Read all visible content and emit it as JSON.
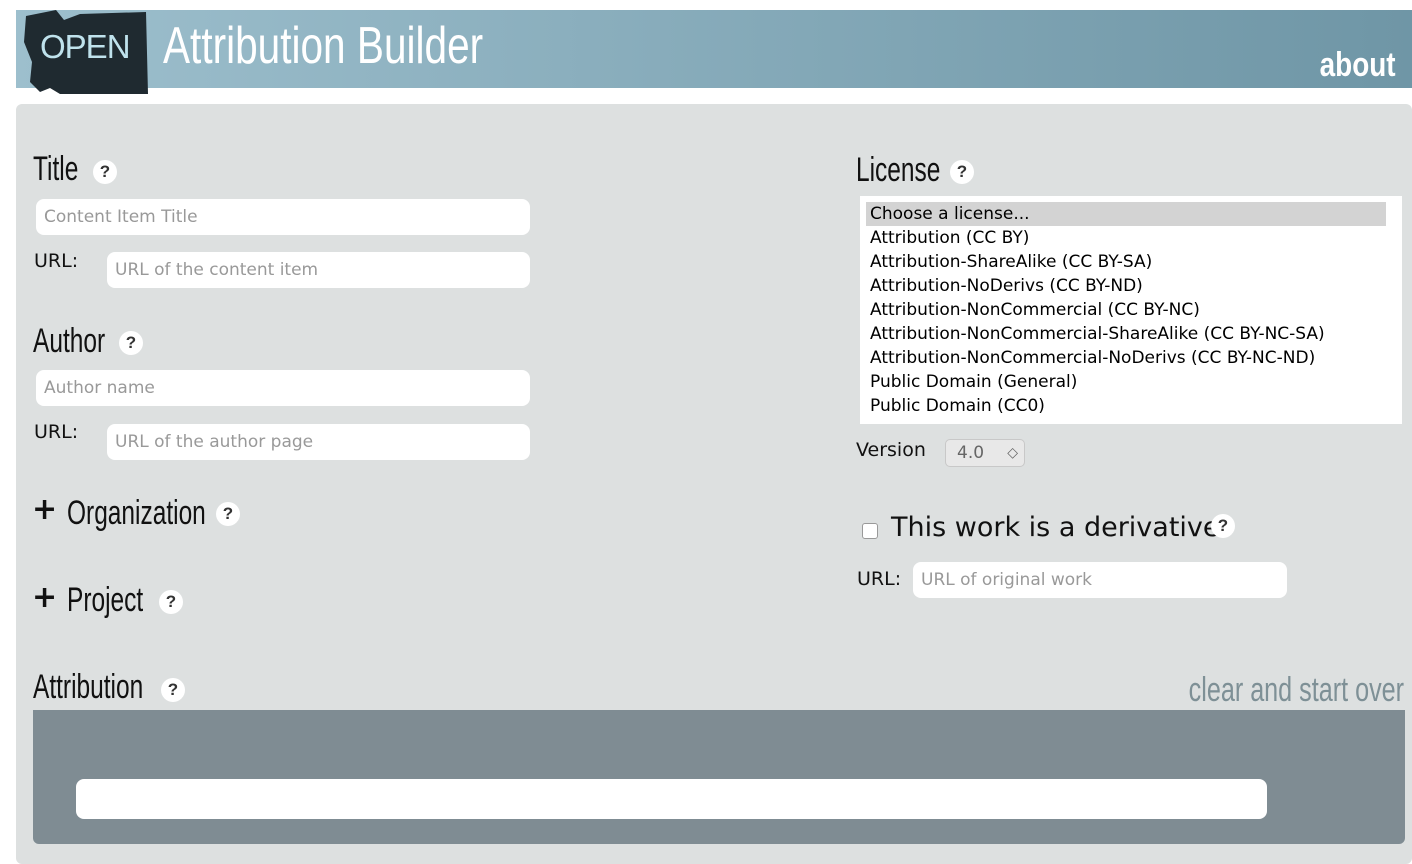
{
  "header": {
    "logo_text": "OPEN",
    "title": "Attribution Builder",
    "about_link": "about"
  },
  "title_section": {
    "heading": "Title",
    "help": "?",
    "title_placeholder": "Content Item Title",
    "url_label": "URL:",
    "url_placeholder": "URL of the content item"
  },
  "author_section": {
    "heading": "Author",
    "help": "?",
    "name_placeholder": "Author name",
    "url_label": "URL:",
    "url_placeholder": "URL of the author page"
  },
  "organization": {
    "toggle": "+",
    "heading": "Organization",
    "help": "?"
  },
  "project": {
    "toggle": "+",
    "heading": "Project",
    "help": "?"
  },
  "license_section": {
    "heading": "License",
    "help": "?",
    "options": [
      "Choose a license...",
      "Attribution (CC BY)",
      "Attribution-ShareAlike (CC BY-SA)",
      "Attribution-NoDerivs (CC BY-ND)",
      "Attribution-NonCommercial (CC BY-NC)",
      "Attribution-NonCommercial-ShareAlike (CC BY-NC-SA)",
      "Attribution-NonCommercial-NoDerivs (CC BY-NC-ND)",
      "Public Domain (General)",
      "Public Domain (CC0)"
    ],
    "selected": "Choose a license...",
    "version_label": "Version",
    "version_value": "4.0",
    "version_arrows": "◇"
  },
  "derivative": {
    "label": "This work is a derivative",
    "help": "?",
    "checked": false,
    "url_label": "URL:",
    "url_placeholder": "URL of original work"
  },
  "attribution": {
    "heading": "Attribution",
    "help": "?",
    "clear_link": "clear and start over",
    "output": ""
  }
}
